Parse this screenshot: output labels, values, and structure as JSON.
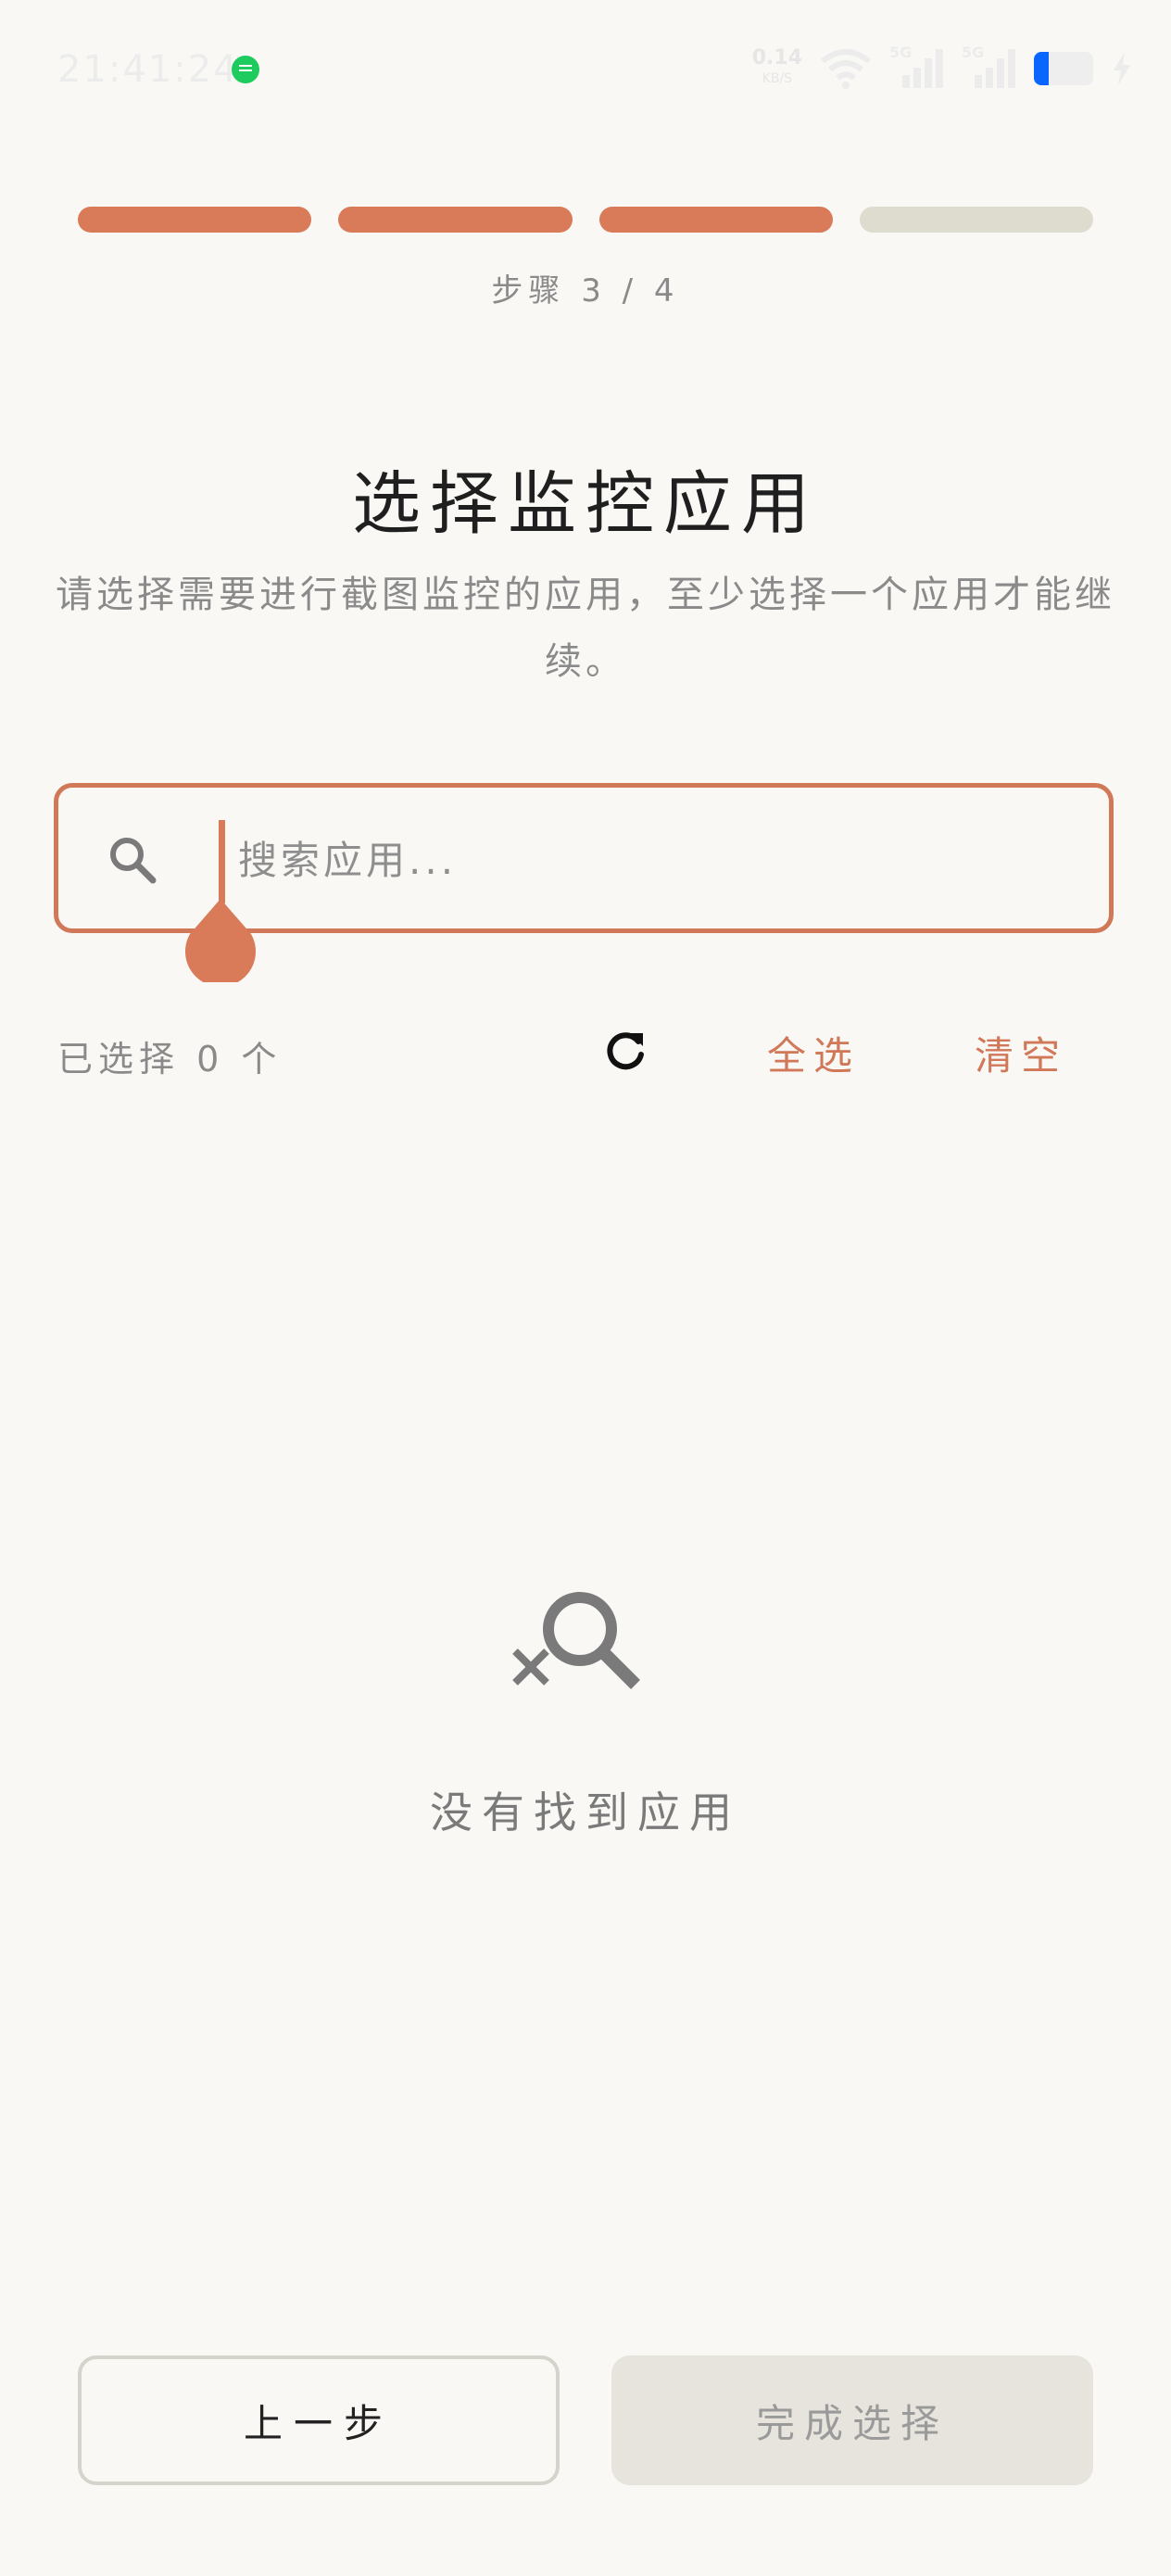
{
  "status_bar": {
    "time": "21:41:24",
    "network_speed": "0.14",
    "network_speed_unit": "KB/S",
    "signal_label_1": "5G",
    "signal_label_2": "5G",
    "battery_level": 0.25,
    "battery_color": "#0a66ff"
  },
  "progress": {
    "steps_total": 4,
    "steps_done": 3,
    "label": "步骤 3 / 4",
    "done_color": "#d97a59",
    "todo_color": "#dedbcf"
  },
  "header": {
    "title": "选择监控应用",
    "subtitle": "请选择需要进行截图监控的应用，至少选择一个应用才能继续。"
  },
  "search": {
    "value": "",
    "placeholder": "搜索应用...",
    "icon": "search-icon"
  },
  "toolbar": {
    "selected_count": "已选择 0 个",
    "refresh_icon": "refresh-icon",
    "select_all_label": "全选",
    "clear_label": "清空",
    "accent_color": "#d07858"
  },
  "empty_state": {
    "icon": "search-off-icon",
    "text": "没有找到应用"
  },
  "footer": {
    "prev_label": "上一步",
    "finish_label": "完成选择"
  }
}
